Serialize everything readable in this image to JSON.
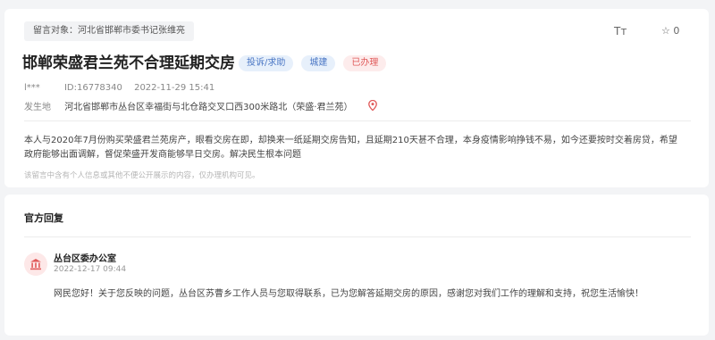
{
  "message": {
    "target_label": "留言对象：河北省邯郸市委书记张维亮",
    "title": "邯郸荣盛君兰苑不合理延期交房",
    "tags": [
      "投诉/求助",
      "城建",
      "已办理"
    ],
    "author": "l***",
    "id_text": "ID:16778340",
    "datetime": "2022-11-29 15:41",
    "location_label": "发生地",
    "location_value": "河北省邯郸市丛台区幸福街与北仓路交叉口西300米路北（荣盛·君兰苑）",
    "body": "本人与2020年7月份购买荣盛君兰苑房产，眼看交房在即，却换来一纸延期交房告知，且延期210天甚不合理，本身疫情影响挣钱不易，如今还要按时交着房贷，希望政府能够出面调解，督促荣盛开发商能够早日交房。解决民生根本问题",
    "privacy_note": "该留言中含有个人信息或其他不便公开展示的内容，仅办理机构可见。"
  },
  "toolbar": {
    "font_icon_text": "Tт",
    "star_count": "☆ 0"
  },
  "reply": {
    "section_title": "官方回复",
    "office_name": "丛台区委办公室",
    "datetime": "2022-12-17 09:44",
    "text": "网民您好！关于您反映的问题，丛台区苏曹乡工作人员与您取得联系，已为您解答延期交房的原因，感谢您对我们工作的理解和支持，祝您生活愉快！"
  },
  "colors": {
    "accent_blue": "#4a76c4",
    "status_red": "#e05a5a",
    "background": "#f3f4f6"
  },
  "icons": [
    "font-size-icon",
    "star-icon",
    "location-pin-icon",
    "government-building-icon"
  ]
}
